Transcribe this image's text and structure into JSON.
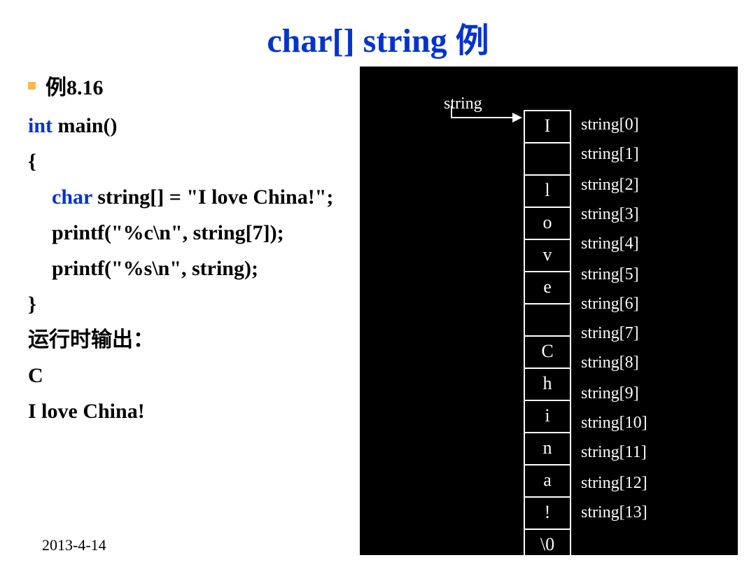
{
  "title": "char[] string 例",
  "example_label": "例8.16",
  "code": {
    "l1_int": "int",
    "l1_rest": " main()",
    "l2": "{",
    "l3_char": "char",
    "l3_rest": " string[] = \"I love China!\";",
    "l4": "printf(\"%c\\n\", string[7]);",
    "l5": "printf(\"%s\\n\", string);",
    "l6": "}"
  },
  "output_label": "运行时输出：",
  "output_1": "C",
  "output_2": "I love China!",
  "footer_date": "2013-4-14",
  "diagram": {
    "pointer_label": "string",
    "cells": [
      "I",
      " ",
      "l",
      "o",
      "v",
      "e",
      " ",
      "C",
      "h",
      "i",
      "n",
      "a",
      "!",
      "\\0"
    ],
    "indices": [
      "string[0]",
      "string[1]",
      "string[2]",
      "string[3]",
      "string[4]",
      "string[5]",
      "string[6]",
      "string[7]",
      "string[8]",
      "string[9]",
      "string[10]",
      "string[11]",
      "string[12]",
      "string[13]"
    ]
  }
}
